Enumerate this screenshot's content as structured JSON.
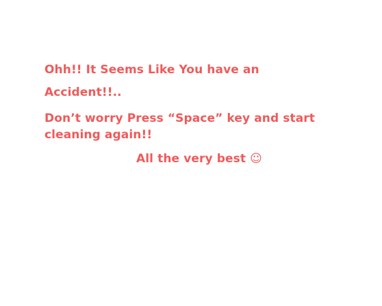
{
  "message": {
    "line1": "Ohh!! It Seems Like You have an",
    "line2": "Accident!!..",
    "line3": "Don’t worry Press “Space” key and start",
    "line4": "cleaning again!!",
    "line5": "All the very best ☺"
  },
  "colors": {
    "text": "#f05a5a",
    "background": "#ffffff"
  }
}
